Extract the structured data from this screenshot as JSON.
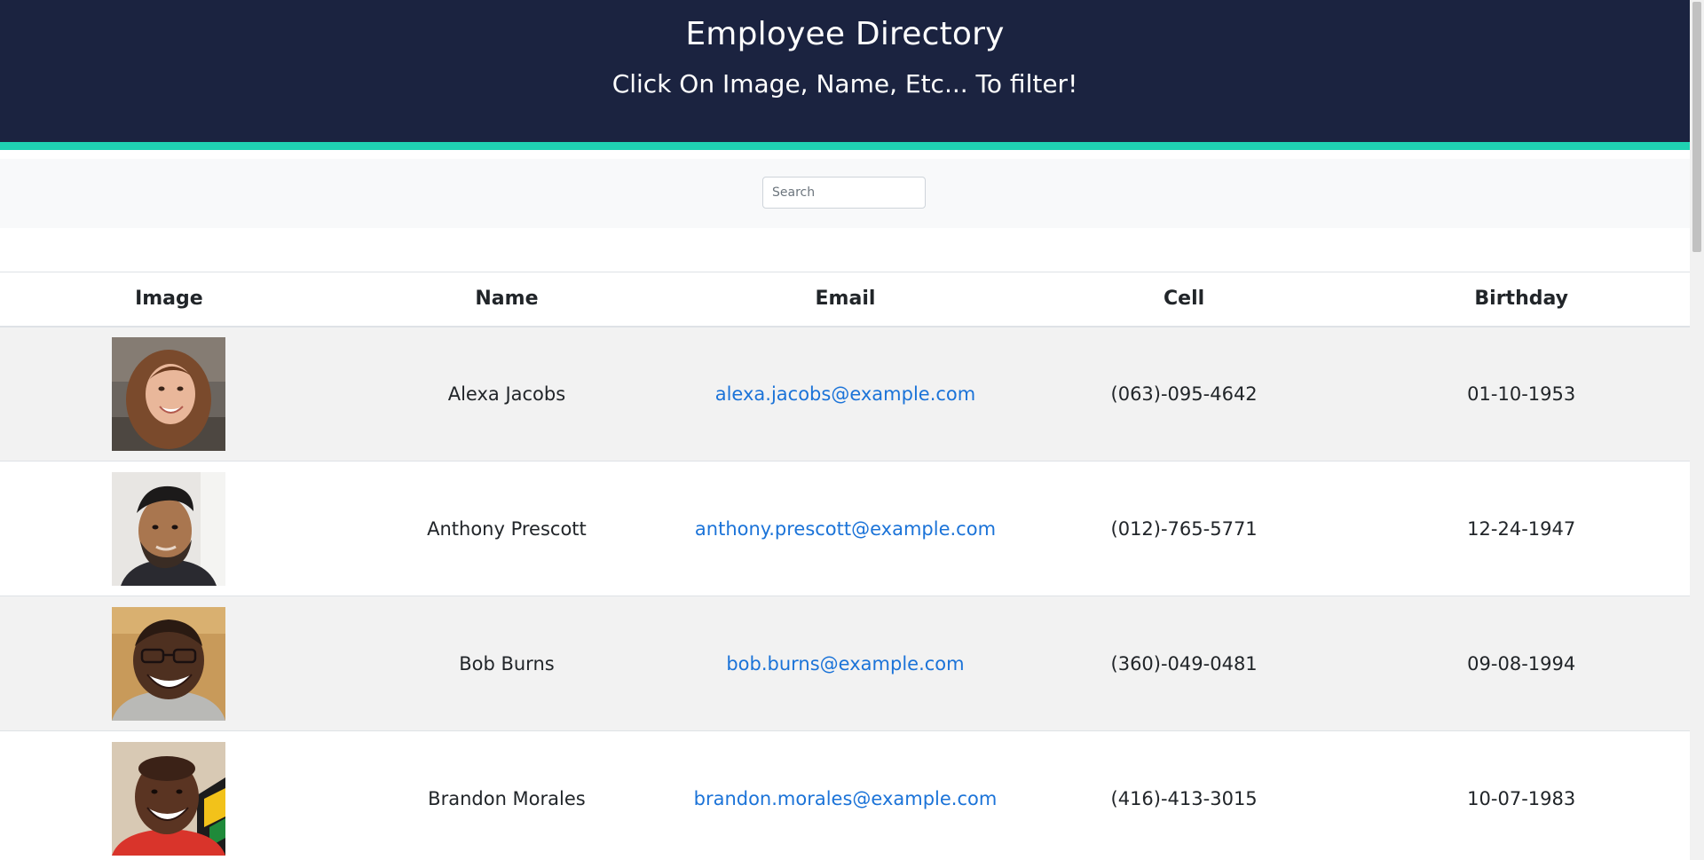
{
  "header": {
    "title": "Employee Directory",
    "subtitle": "Click On Image, Name, Etc... To filter!"
  },
  "search": {
    "placeholder": "Search",
    "value": ""
  },
  "table": {
    "columns": [
      "Image",
      "Name",
      "Email",
      "Cell",
      "Birthday"
    ],
    "rows": [
      {
        "name": "Alexa Jacobs",
        "email": "alexa.jacobs@example.com",
        "cell": "(063)-095-4642",
        "birthday": "01-10-1953",
        "image": "woman-portrait"
      },
      {
        "name": "Anthony Prescott",
        "email": "anthony.prescott@example.com",
        "cell": "(012)-765-5771",
        "birthday": "12-24-1947",
        "image": "bearded-man-portrait"
      },
      {
        "name": "Bob Burns",
        "email": "bob.burns@example.com",
        "cell": "(360)-049-0481",
        "birthday": "09-08-1994",
        "image": "smiling-man-glasses-portrait"
      },
      {
        "name": "Brandon Morales",
        "email": "brandon.morales@example.com",
        "cell": "(416)-413-3015",
        "birthday": "10-07-1983",
        "image": "smiling-man-red-shirt-portrait"
      }
    ]
  },
  "colors": {
    "header_bg": "#1b2340",
    "accent": "#1fd1b2",
    "link": "#1b73d8",
    "stripe": "#f2f2f2"
  }
}
